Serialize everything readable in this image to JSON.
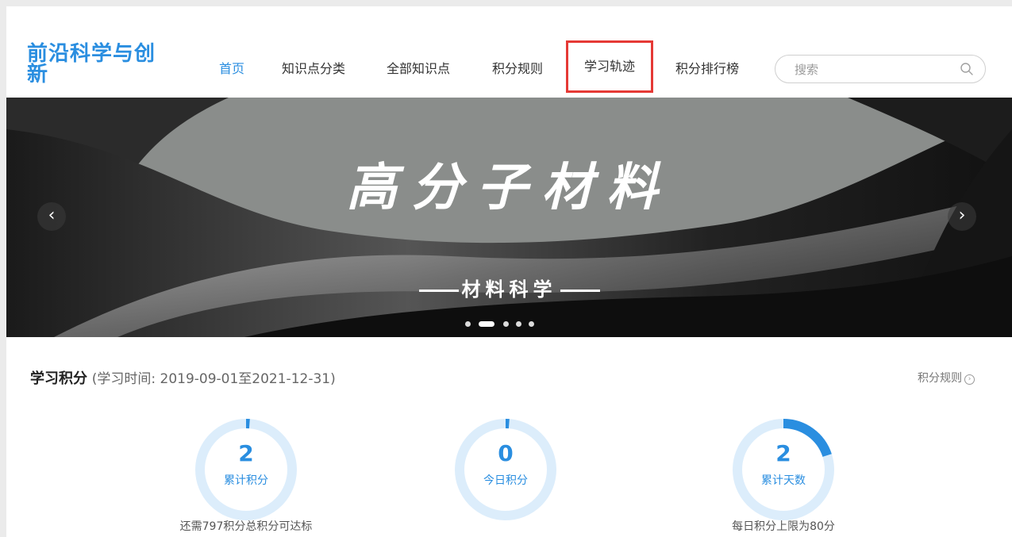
{
  "header": {
    "logo": "前沿科学与创新",
    "nav": [
      {
        "label": "首页"
      },
      {
        "label": "知识点分类"
      },
      {
        "label": "全部知识点"
      },
      {
        "label": "积分规则"
      },
      {
        "label": "学习轨迹"
      },
      {
        "label": "积分排行榜"
      }
    ],
    "search_placeholder": "搜索"
  },
  "banner": {
    "title": "高分子材料",
    "subtitle": "材料科学",
    "prev_glyph": "‹",
    "next_glyph": "›",
    "slide_count": 5,
    "active_slide": 2
  },
  "points": {
    "title": "学习积分",
    "period": "(学习时间: 2019-09-01至2021-12-31)",
    "rule_link": "积分规则",
    "stats": [
      {
        "value": "2",
        "label": "累计积分",
        "note": "还需797积分总积分可达标",
        "progress": 0.003
      },
      {
        "value": "0",
        "label": "今日积分",
        "note": "",
        "progress": 0.0
      },
      {
        "value": "2",
        "label": "累计天数",
        "note": "每日积分上限为80分",
        "progress": 0.2
      }
    ]
  },
  "colors": {
    "accent": "#2a8ee0",
    "highlight_box": "#e53935",
    "ring_track": "#dcedfb"
  }
}
